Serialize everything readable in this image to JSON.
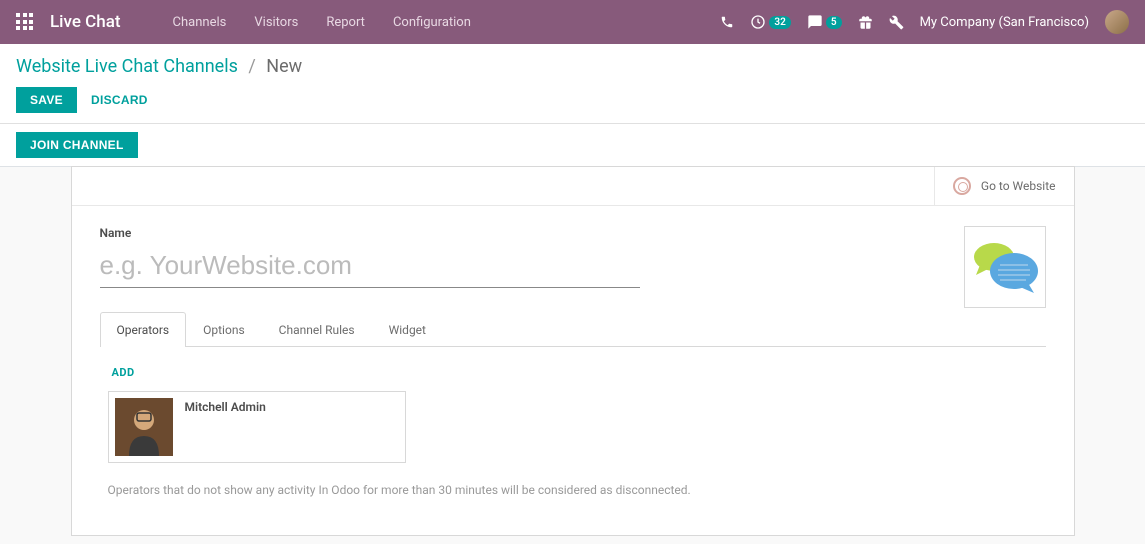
{
  "topbar": {
    "brand": "Live Chat",
    "nav": [
      "Channels",
      "Visitors",
      "Report",
      "Configuration"
    ],
    "timer_badge": "32",
    "chat_badge": "5",
    "company": "My Company (San Francisco)"
  },
  "breadcrumb": {
    "parent": "Website Live Chat Channels",
    "current": "New"
  },
  "actions": {
    "save": "SAVE",
    "discard": "DISCARD",
    "join": "JOIN CHANNEL"
  },
  "sheet": {
    "goto_website": "Go to Website",
    "name_label": "Name",
    "name_placeholder": "e.g. YourWebsite.com",
    "name_value": ""
  },
  "tabs": [
    "Operators",
    "Options",
    "Channel Rules",
    "Widget"
  ],
  "operators": {
    "add": "ADD",
    "list": [
      {
        "name": "Mitchell Admin"
      }
    ],
    "hint": "Operators that do not show any activity In Odoo for more than 30 minutes will be considered as disconnected."
  }
}
